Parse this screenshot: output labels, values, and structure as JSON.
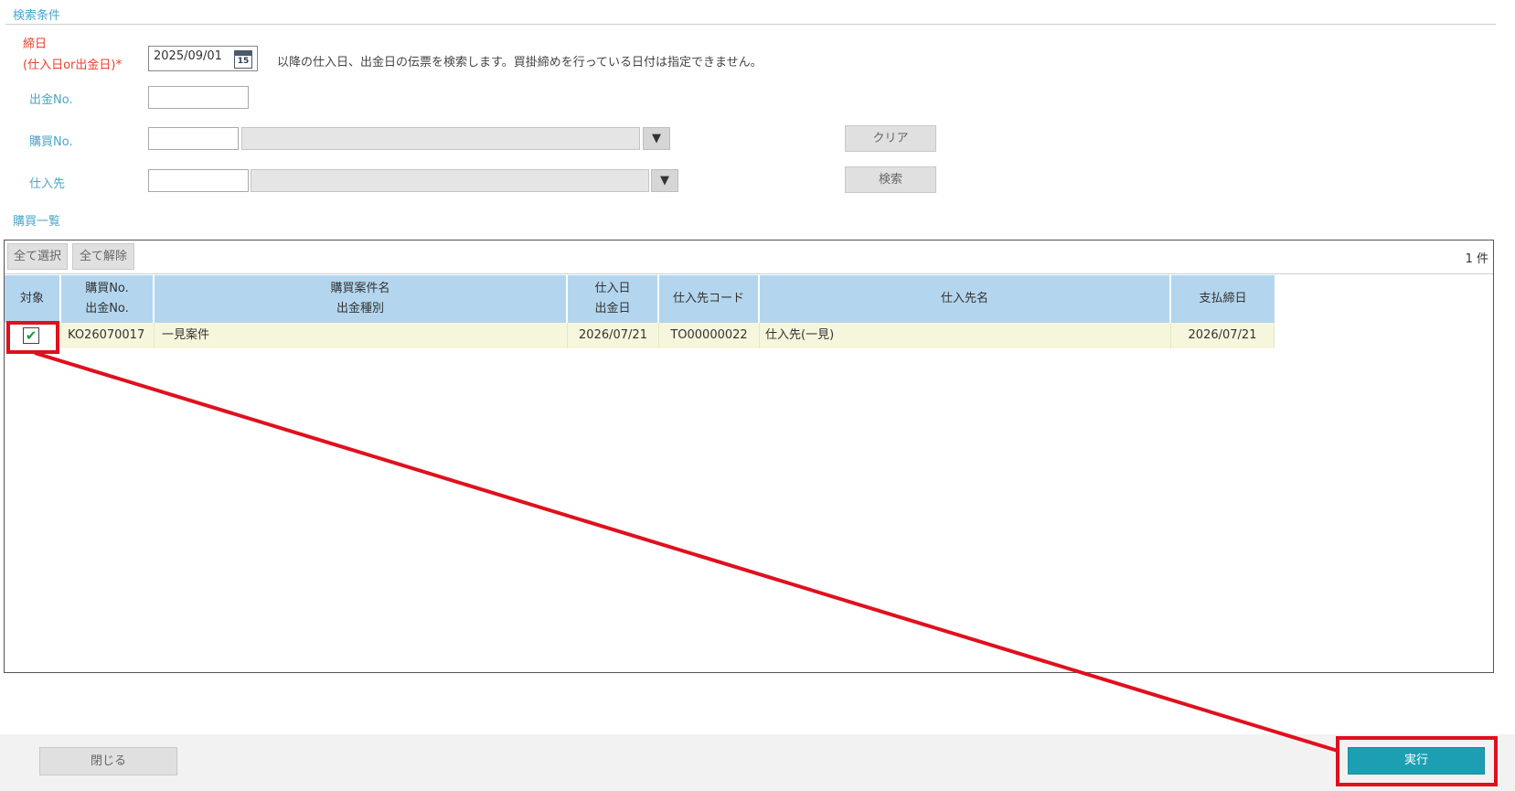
{
  "search": {
    "section_title": "検索条件",
    "closing_date_label_line1": "締日",
    "closing_date_label_line2": "(仕入日or出金日)",
    "required_mark": "*",
    "closing_date_value": "2025/09/01",
    "calendar_icon_text": "15",
    "closing_date_note": "以降の仕入日、出金日の伝票を検索します。買掛締めを行っている日付は指定できません。",
    "payment_no_label": "出金No.",
    "payment_no_value": "",
    "purchase_no_label": "購買No.",
    "purchase_no_value": "",
    "supplier_label": "仕入先",
    "supplier_value": "",
    "dropdown_glyph": "▼",
    "clear_button": "クリア",
    "search_button": "検索"
  },
  "list": {
    "section_title": "購買一覧",
    "select_all_button": "全て選択",
    "deselect_all_button": "全て解除",
    "count_text": "1 件",
    "columns": [
      {
        "line1": "対象",
        "line2": ""
      },
      {
        "line1": "購買No.",
        "line2": "出金No."
      },
      {
        "line1": "購買案件名",
        "line2": "出金種別"
      },
      {
        "line1": "仕入日",
        "line2": "出金日"
      },
      {
        "line1": "仕入先コード",
        "line2": ""
      },
      {
        "line1": "仕入先名",
        "line2": ""
      },
      {
        "line1": "支払締日",
        "line2": ""
      }
    ],
    "rows": [
      {
        "checked": "✔",
        "purchase_no": "KO26070017",
        "project_name": "一見案件",
        "date": "2026/07/21",
        "supplier_code": "TO00000022",
        "supplier_name": "仕入先(一見)",
        "closing_date": "2026/07/21"
      }
    ]
  },
  "footer": {
    "close_button": "閉じる",
    "execute_button": "実行"
  },
  "colors": {
    "label_blue": "#4aa6c8",
    "required_red": "#e8412b",
    "header_blue": "#b3d6ee",
    "row_highlight": "#f6f6dc",
    "execute_teal": "#1d9fb3",
    "annotation_red": "#e0101e"
  }
}
